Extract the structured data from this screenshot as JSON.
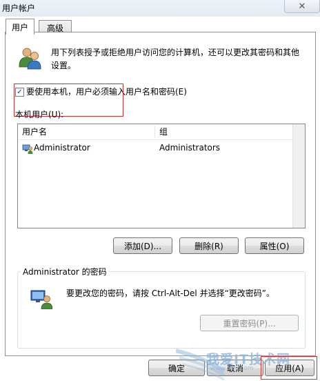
{
  "window": {
    "title": "用户帐户",
    "close_glyph": "✕"
  },
  "tabs": [
    {
      "label": "用户",
      "active": true
    },
    {
      "label": "高级",
      "active": false
    }
  ],
  "users_tab": {
    "intro": "用下列表授予或拒绝用户访问您的计算机，还可以更改其密码和其他设置。",
    "require_login_checkbox": {
      "label": "要使用本机，用户必须输入用户名和密码(E)",
      "checked": true
    },
    "local_users_label": "本机用户(U):",
    "user_list": {
      "columns": [
        "用户名",
        "组"
      ],
      "rows": [
        {
          "name": "Administrator",
          "group": "Administrators",
          "icon": "user-computer-icon"
        }
      ]
    },
    "buttons": {
      "add": "添加(D)...",
      "remove": "删除(R)",
      "properties": "属性(O)"
    },
    "password_group": {
      "title": "Administrator 的密码",
      "text": "要更改您的密码，请按 Ctrl-Alt-Del 并选择“更改密码”。",
      "reset_button": "重置密码(P)..."
    }
  },
  "dialog_buttons": {
    "ok": "确定",
    "cancel": "取消",
    "apply": "应用(A)"
  },
  "watermark": {
    "text": "我爱IT技术网",
    "sub": "www.52ij.com"
  },
  "colors": {
    "highlight_red": "#d03030",
    "border": "#8e8f8f",
    "watermark": "#8ab4dc"
  }
}
